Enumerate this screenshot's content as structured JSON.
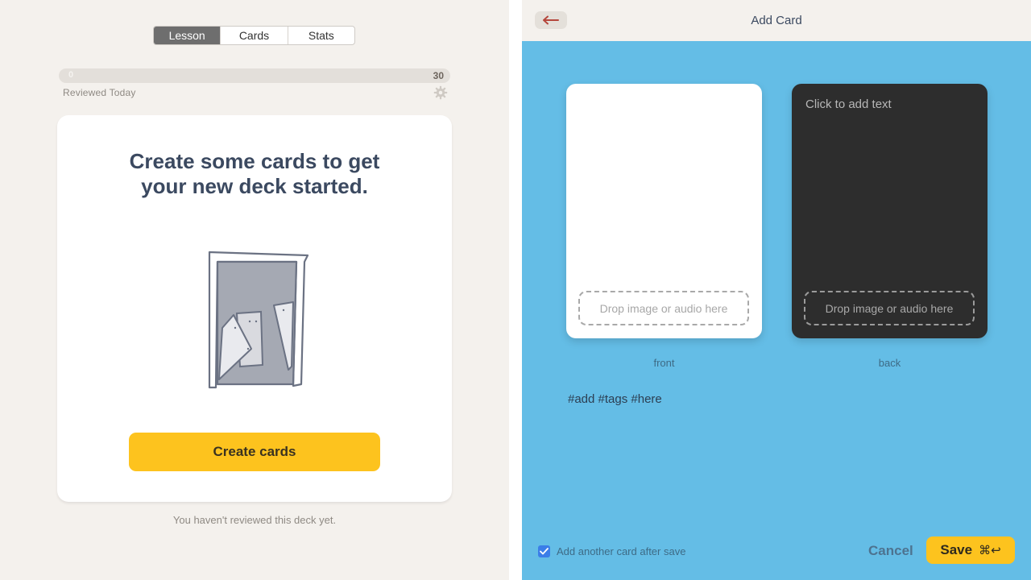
{
  "left": {
    "tabs": [
      {
        "label": "Lesson",
        "active": true
      },
      {
        "label": "Cards",
        "active": false
      },
      {
        "label": "Stats",
        "active": false
      }
    ],
    "progress": {
      "min": "0",
      "max": "30",
      "value": 0,
      "label": "Reviewed Today"
    },
    "empty_card": {
      "title_line1": "Create some cards to get",
      "title_line2": "your new deck started.",
      "button_label": "Create cards"
    },
    "footer_note": "You haven't reviewed this deck yet."
  },
  "right": {
    "header": {
      "title": "Add Card",
      "back_icon": "arrow-left-icon"
    },
    "front": {
      "drop_label": "Drop image or audio here",
      "caption": "front"
    },
    "back": {
      "placeholder": "Click to add text",
      "drop_label": "Drop image or audio here",
      "caption": "back"
    },
    "tags_placeholder": "#add #tags #here",
    "add_another": {
      "label": "Add another card after save",
      "checked": true
    },
    "cancel_label": "Cancel",
    "save_label": "Save",
    "save_shortcut": "⌘↩"
  },
  "colors": {
    "accent_yellow": "#fdc31e",
    "right_bg": "#64bde6",
    "left_bg": "#f4f1ed",
    "title_navy": "#3b4960",
    "checkbox_blue": "#3b7ee8"
  }
}
